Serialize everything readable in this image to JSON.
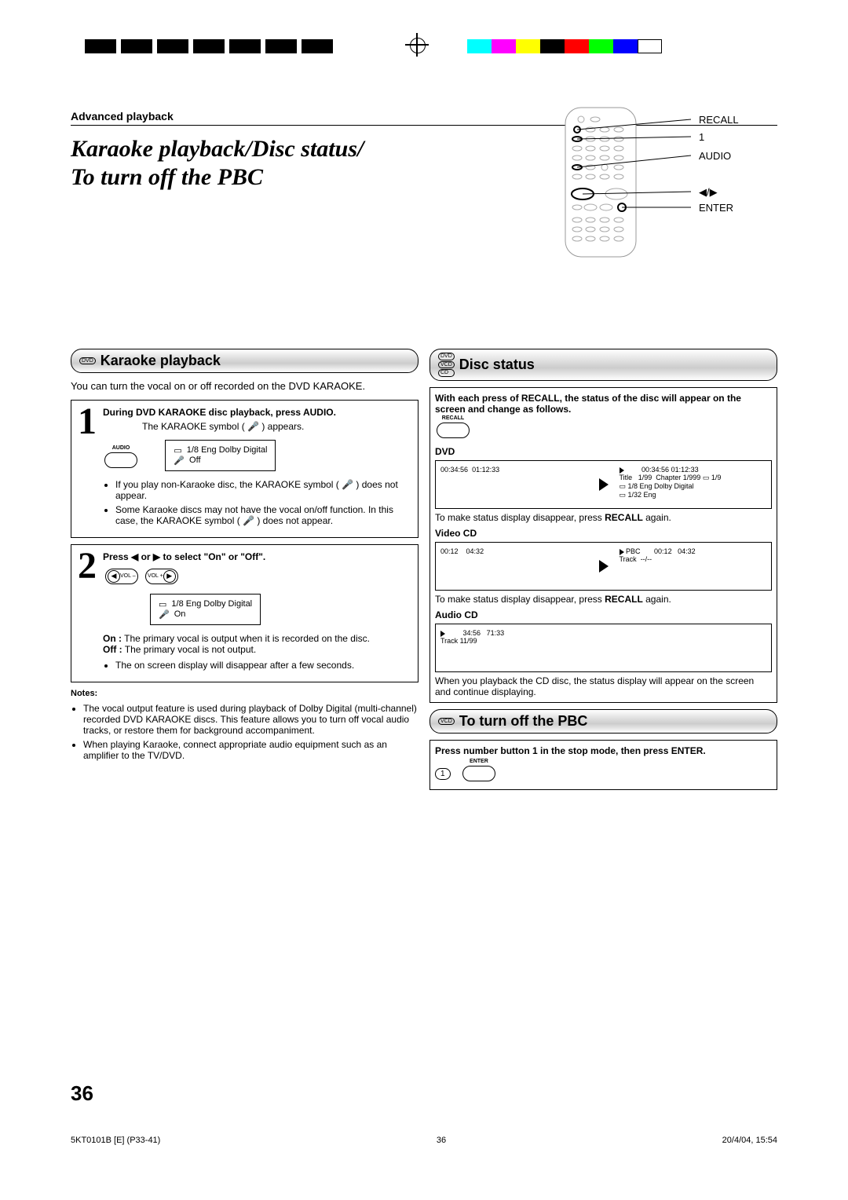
{
  "header": {
    "section": "Advanced playback"
  },
  "title": "Karaoke playback/Disc status/\nTo turn off the PBC",
  "remoteLabels": {
    "recall": "RECALL",
    "one": "1",
    "audio": "AUDIO",
    "arrows": "◀/▶",
    "enter": "ENTER"
  },
  "karaoke": {
    "tag": "DVD",
    "heading": "Karaoke playback",
    "intro": "You can turn the vocal on or off recorded on the DVD KARAOKE.",
    "step1": {
      "text": "During DVD KARAOKE disc playback, press AUDIO.",
      "sub": "The KARAOKE symbol ( 🎤 ) appears.",
      "btnLabel": "AUDIO",
      "osdLine1": "1/8 Eng Dolby Digital",
      "osdLine2": "Off",
      "bullets": [
        "If you play non-Karaoke disc, the KARAOKE symbol ( 🎤 ) does not appear.",
        "Some Karaoke discs may not have the vocal on/off function. In this case, the KARAOKE symbol ( 🎤 ) does not appear."
      ]
    },
    "step2": {
      "text": "Press ◀ or ▶ to select \"On\" or \"Off\".",
      "volMinus": "VOL –",
      "volPlus": "VOL +",
      "osdLine1": "1/8 Eng Dolby Digital",
      "osdLine2": "On",
      "onLabel": "On :",
      "onText": "The primary vocal is output when it is recorded on the disc.",
      "offLabel": "Off :",
      "offText": "The primary vocal is not output.",
      "bullets": [
        "The on screen display will disappear after a few seconds."
      ]
    },
    "notes": {
      "heading": "Notes:",
      "items": [
        "The vocal output feature is used during playback of Dolby Digital (multi-channel) recorded DVD KARAOKE discs. This feature allows you to turn off vocal audio tracks, or restore them for background accompaniment.",
        "When playing Karaoke, connect appropriate audio equipment such as an amplifier to the TV/DVD."
      ]
    }
  },
  "discstatus": {
    "tags": [
      "DVD",
      "VCD",
      "CD"
    ],
    "heading": "Disc status",
    "intro": "With each press of RECALL, the status of the disc will appear on the screen and change as follows.",
    "recallLabel": "RECALL",
    "dvd": {
      "label": "DVD",
      "left": {
        "t1": "00:34:56",
        "t2": "01:12:33"
      },
      "right": {
        "t1": "00:34:56",
        "t2": "01:12:33",
        "title": "Title",
        "titleVal": "1/99",
        "chapter": "Chapter",
        "chapterVal": "1/999",
        "ang": "1/9",
        "audio": "1/8  Eng Dolby Digital",
        "sub": "1/32  Eng"
      },
      "after": "To make status display disappear, press ",
      "afterBold": "RECALL",
      "after2": " again."
    },
    "vcd": {
      "label": "Video CD",
      "left": {
        "t1": "00:12",
        "t2": "04:32"
      },
      "right": {
        "pbc": "PBC",
        "t1": "00:12",
        "t2": "04:32",
        "track": "Track",
        "trackVal": "--/--"
      },
      "after": "To make status display disappear, press ",
      "afterBold": "RECALL",
      "after2": " again."
    },
    "cd": {
      "label": "Audio CD",
      "t1": "34:56",
      "t2": "71:33",
      "track": "Track 11/99",
      "after": "When you playback the CD disc, the status display will appear on the screen and continue displaying."
    }
  },
  "pbc": {
    "tag": "VCD",
    "heading": "To turn off the PBC",
    "text": "Press number button 1 in the stop mode, then press ENTER.",
    "btn1": "1",
    "enterLabel": "ENTER"
  },
  "pageNum": "36",
  "footer": {
    "left": "5KT0101B [E] (P33-41)",
    "center": "36",
    "right": "20/4/04, 15:54"
  }
}
